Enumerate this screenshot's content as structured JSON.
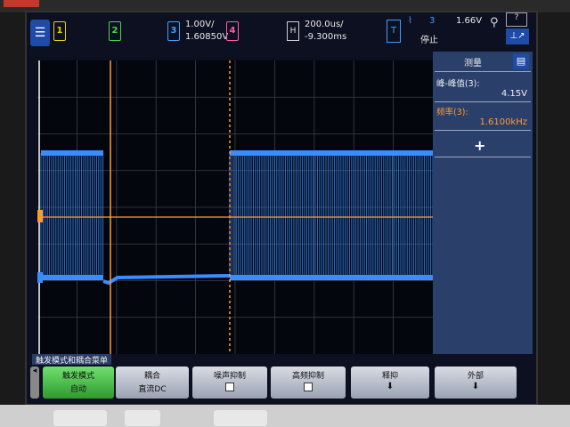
{
  "topbar": {
    "ch1_label": "1",
    "ch2_label": "2",
    "ch3_label": "3",
    "ch3_scale": "1.00V/",
    "ch3_offset": "1.60850V",
    "ch4_label": "4",
    "h_label": "H",
    "timebase": "200.0us/",
    "delay": "-9.300ms",
    "trig_t": "T",
    "trig_source": "3",
    "trig_state": "停止",
    "trig_level": "1.66V"
  },
  "measure": {
    "title": "测量",
    "item1_label": "峰-峰值(3):",
    "item1_value": "4.15V",
    "item2_label": "频率(3):",
    "item2_value": "1.6100kHz",
    "add_symbol": "+"
  },
  "softkeys": {
    "menu_title": "触发模式和耦合菜单",
    "k1_line1": "触发模式",
    "k1_line2": "自动",
    "k2_line1": "耦合",
    "k2_line2": "直流DC",
    "k3_line1": "噪声抑制",
    "k4_line1": "高频抑制",
    "k5_line1": "释抑",
    "k6_line1": "外部"
  },
  "colors": {
    "ch1": "#e6d400",
    "ch2": "#3fdc3f",
    "ch3": "#3fa0ff",
    "ch4": "#ff5ca8",
    "trace": "#3a8cff",
    "cursor": "#ff9a30",
    "active_key": "#4fc04f"
  }
}
